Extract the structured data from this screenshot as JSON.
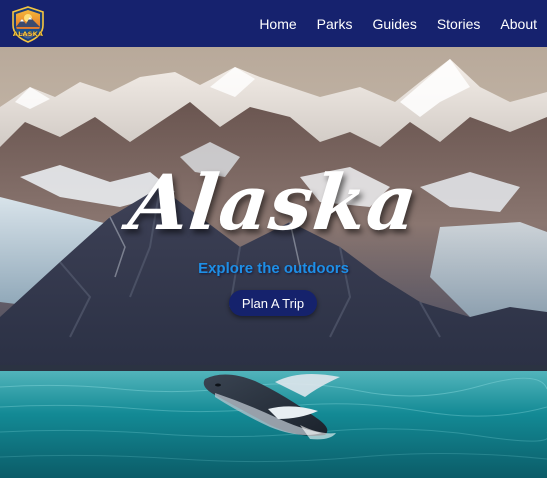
{
  "brand": {
    "logo_text": "ALASKA"
  },
  "nav": {
    "items": [
      {
        "label": "Home"
      },
      {
        "label": "Parks"
      },
      {
        "label": "Guides"
      },
      {
        "label": "Stories"
      },
      {
        "label": "About"
      }
    ]
  },
  "hero": {
    "title": "Alaska",
    "subtitle": "Explore the outdoors",
    "cta_label": "Plan A Trip"
  },
  "colors": {
    "nav_bg": "#16226e",
    "subtitle": "#1e8fe6",
    "cta_bg": "#15226c",
    "logo_gold": "#f5c540"
  },
  "icons": [
    "alaska-logo-badge-icon"
  ]
}
